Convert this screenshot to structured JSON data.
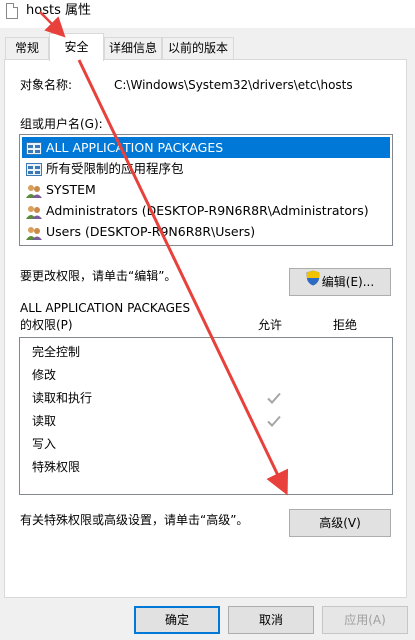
{
  "window": {
    "title": "hosts 属性"
  },
  "tabs": [
    {
      "label": "常规",
      "active": false
    },
    {
      "label": "安全",
      "active": true
    },
    {
      "label": "详细信息",
      "active": false
    },
    {
      "label": "以前的版本",
      "active": false
    }
  ],
  "object": {
    "label": "对象名称:",
    "value": "C:\\Windows\\System32\\drivers\\etc\\hosts"
  },
  "groups": {
    "label": "组或用户名(G):",
    "items": [
      {
        "name": "ALL APPLICATION PACKAGES",
        "icon": "app-packages-icon",
        "selected": true
      },
      {
        "name": "所有受限制的应用程序包",
        "icon": "app-packages-icon",
        "selected": false
      },
      {
        "name": "SYSTEM",
        "icon": "users-group-icon",
        "selected": false
      },
      {
        "name": "Administrators (DESKTOP-R9N6R8R\\Administrators)",
        "icon": "users-group-icon",
        "selected": false
      },
      {
        "name": "Users (DESKTOP-R9N6R8R\\Users)",
        "icon": "users-group-icon",
        "selected": false
      }
    ]
  },
  "edit": {
    "hint": "要更改权限，请单击“编辑”。",
    "button_label": "编辑(E)...",
    "button_icon": "uac-shield-icon"
  },
  "permissions": {
    "title_line1": "ALL APPLICATION PACKAGES",
    "title_line2": "的权限(P)",
    "allow_header": "允许",
    "deny_header": "拒绝",
    "rows": [
      {
        "name": "完全控制",
        "allow": false,
        "deny": false
      },
      {
        "name": "修改",
        "allow": false,
        "deny": false
      },
      {
        "name": "读取和执行",
        "allow": true,
        "deny": false
      },
      {
        "name": "读取",
        "allow": true,
        "deny": false
      },
      {
        "name": "写入",
        "allow": false,
        "deny": false
      },
      {
        "name": "特殊权限",
        "allow": false,
        "deny": false
      }
    ]
  },
  "advanced": {
    "hint": "有关特殊权限或高级设置，请单击“高级”。",
    "button_label": "高级(V)"
  },
  "footer": {
    "ok_label": "确定",
    "cancel_label": "取消",
    "apply_label": "应用(A)"
  },
  "colors": {
    "selection": "#0078d7",
    "annotation_arrow": "#e8413b",
    "check_gray": "#a6a6a6"
  }
}
